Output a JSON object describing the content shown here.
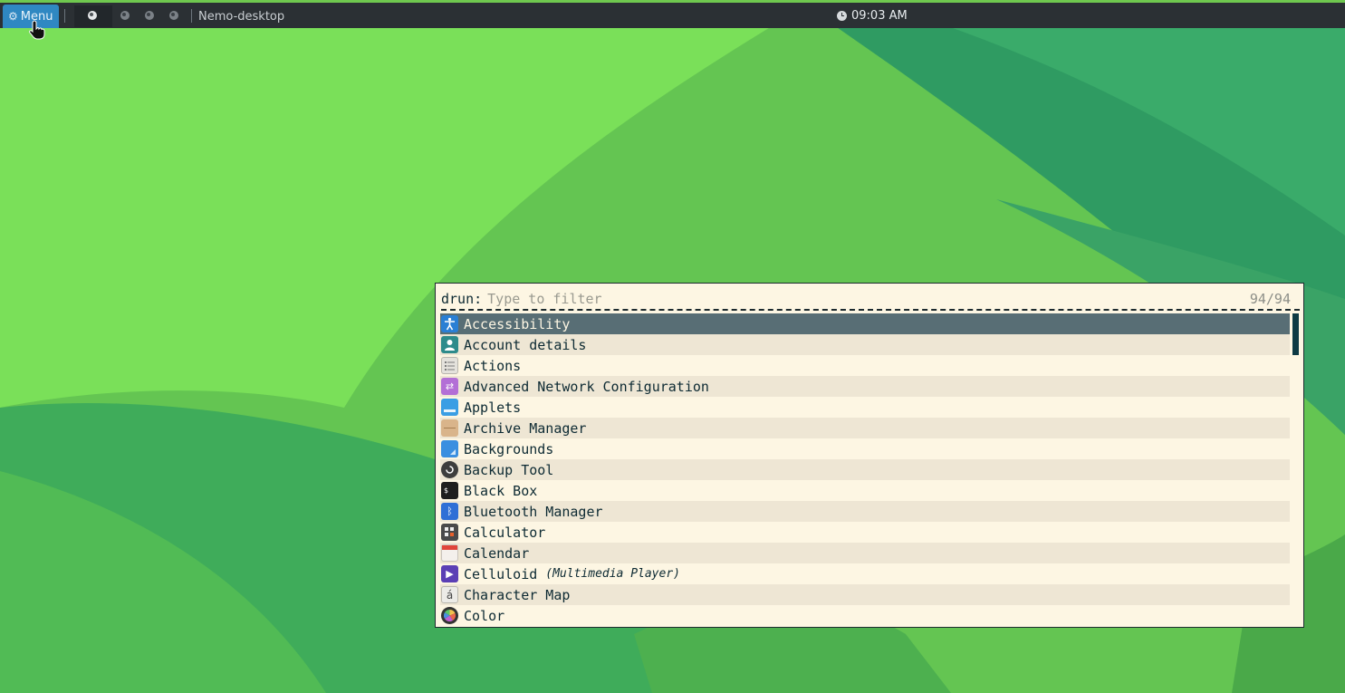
{
  "panel": {
    "menu_label": "Menu",
    "window_title": "Nemo-desktop",
    "clock": "09:03 AM"
  },
  "launcher": {
    "prompt": "drun:",
    "placeholder": "Type to filter",
    "count": "94/94",
    "items": [
      {
        "label": "Accessibility",
        "icon": "accessibility-icon",
        "color": "#2a7fd4",
        "selected": true
      },
      {
        "label": "Account details",
        "icon": "account-icon",
        "color": "#2e8b8b"
      },
      {
        "label": "Actions",
        "icon": "list-icon",
        "color": "#e4e2dc"
      },
      {
        "label": "Advanced Network Configuration",
        "icon": "network-icon",
        "color": "#b36fd6"
      },
      {
        "label": "Applets",
        "icon": "applets-icon",
        "color": "#3a9ee4"
      },
      {
        "label": "Archive Manager",
        "icon": "archive-icon",
        "color": "#d9b48a"
      },
      {
        "label": "Backgrounds",
        "icon": "backgrounds-icon",
        "color": "#3b8fe0"
      },
      {
        "label": "Backup Tool",
        "icon": "backup-icon",
        "color": "#3d3d3d"
      },
      {
        "label": "Black Box",
        "icon": "terminal-icon",
        "color": "#1e1e1e"
      },
      {
        "label": "Bluetooth Manager",
        "icon": "bluetooth-icon",
        "color": "#2f6fd6"
      },
      {
        "label": "Calculator",
        "icon": "calculator-icon",
        "color": "#4a4a4a"
      },
      {
        "label": "Calendar",
        "icon": "calendar-icon",
        "color": "#f4f0ec"
      },
      {
        "label": "Celluloid",
        "subtitle": "(Multimedia Player)",
        "icon": "play-icon",
        "color": "#5b3fb5"
      },
      {
        "label": "Character Map",
        "icon": "character-map-icon",
        "color": "#ecebe7"
      },
      {
        "label": "Color",
        "icon": "color-icon",
        "color": "#333333"
      }
    ]
  }
}
